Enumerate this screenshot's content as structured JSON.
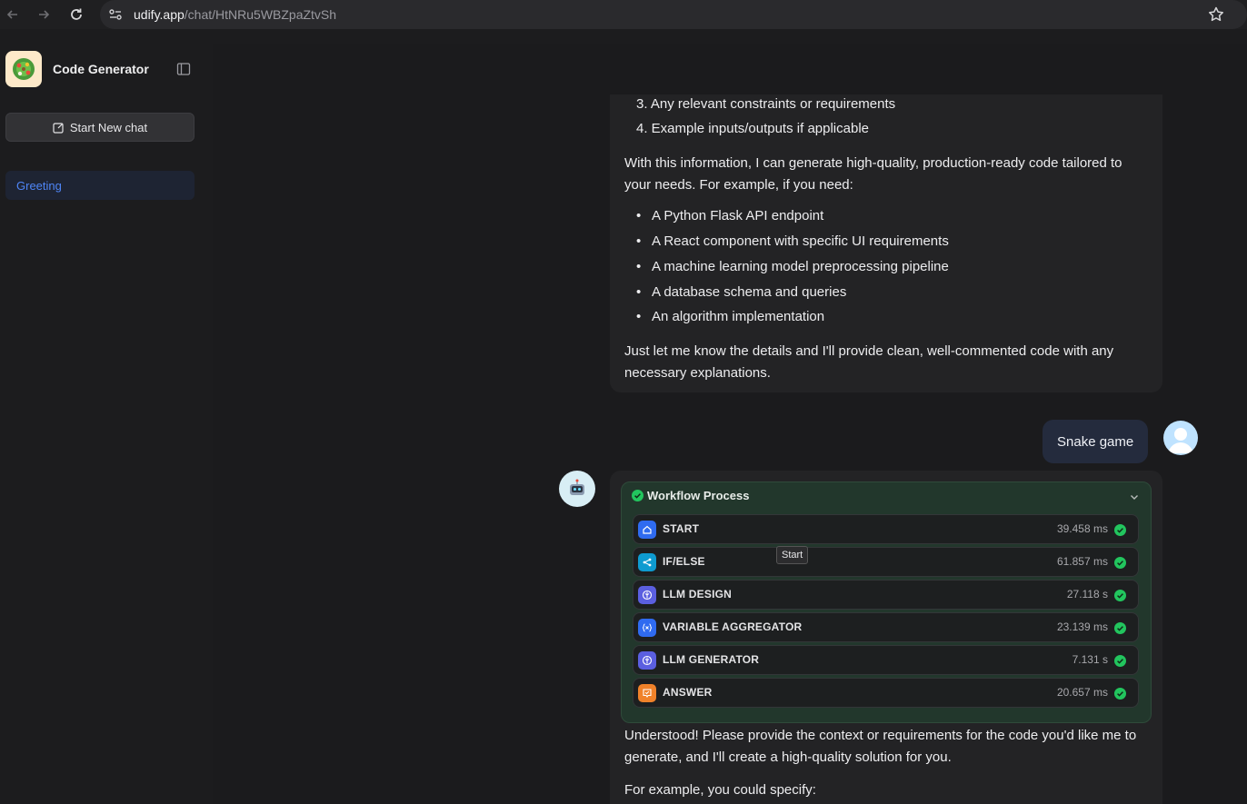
{
  "browser": {
    "url_host": "udify.app",
    "url_path": "/chat/HtNRu5WBZpaZtvSh"
  },
  "sidebar": {
    "app_title": "Code Generator",
    "new_chat_label": "Start New chat",
    "items": [
      {
        "label": "Greeting",
        "active": true
      }
    ]
  },
  "conversation": {
    "previous_answer": {
      "list_items": [
        "3. Any relevant constraints or requirements",
        "4. Example inputs/outputs if applicable"
      ],
      "para1": "With this information, I can generate high-quality, production-ready code tailored to your needs. For example, if you need:",
      "bullets": [
        "A Python Flask API endpoint",
        "A React component with specific UI requirements",
        "A machine learning model preprocessing pipeline",
        "A database schema and queries",
        "An algorithm implementation"
      ],
      "para2": "Just let me know the details and I'll provide clean, well-commented code with any necessary explanations."
    },
    "user_message": "Snake game",
    "workflow": {
      "title": "Workflow Process",
      "nodes": [
        {
          "name": "START",
          "time": "39.458 ms",
          "icon": "home-icon",
          "color": "#2f6bf0"
        },
        {
          "name": "IF/ELSE",
          "time": "61.857 ms",
          "icon": "branch-icon",
          "color": "#0e9bd0"
        },
        {
          "name": "LLM DESIGN",
          "time": "27.118 s",
          "icon": "llm-icon",
          "color": "#5b5fe0"
        },
        {
          "name": "VARIABLE AGGREGATOR",
          "time": "23.139 ms",
          "icon": "variable-icon",
          "color": "#2f6bf0"
        },
        {
          "name": "LLM GENERATOR",
          "time": "7.131 s",
          "icon": "llm-icon",
          "color": "#5b5fe0"
        },
        {
          "name": "ANSWER",
          "time": "20.657 ms",
          "icon": "answer-icon",
          "color": "#f0822a"
        }
      ],
      "tooltip": "Start"
    },
    "answer": {
      "para1": "Understood! Please provide the context or requirements for the code you'd like me to generate, and I'll create a high-quality solution for you.",
      "para2": "For example, you could specify:"
    }
  },
  "colors": {
    "success": "#22c55e",
    "accent": "#4f86f7"
  }
}
